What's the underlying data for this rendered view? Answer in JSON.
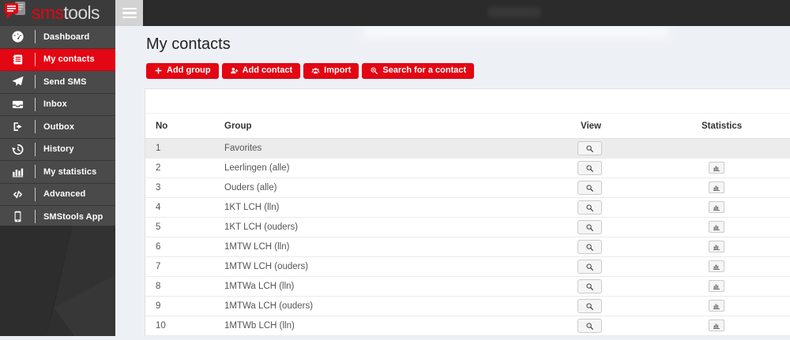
{
  "colors": {
    "brand_red": "#e30613",
    "sidebar_item_bg": "#4a4a4a",
    "topbar_bg": "#2b2b2b",
    "content_bg": "#edf0f5",
    "row_highlight": "#ececec"
  },
  "topbar": {
    "logo_sms": "sms",
    "logo_tools": "tools",
    "menu_toggle_icon": "hamburger-icon"
  },
  "sidebar": {
    "items": [
      {
        "label": "Dashboard",
        "icon": "gauge",
        "active": false
      },
      {
        "label": "My contacts",
        "icon": "address-book",
        "active": true
      },
      {
        "label": "Send SMS",
        "icon": "paper-plane",
        "active": false
      },
      {
        "label": "Inbox",
        "icon": "inbox",
        "active": false
      },
      {
        "label": "Outbox",
        "icon": "sign-out",
        "active": false
      },
      {
        "label": "History",
        "icon": "history",
        "active": false
      },
      {
        "label": "My statistics",
        "icon": "bar-chart",
        "active": false
      },
      {
        "label": "Advanced",
        "icon": "code",
        "active": false
      },
      {
        "label": "SMStools App",
        "icon": "mobile",
        "active": false
      }
    ]
  },
  "main": {
    "title": "My contacts",
    "buttons": [
      {
        "label": "Add group",
        "icon": "plus"
      },
      {
        "label": "Add contact",
        "icon": "user-plus"
      },
      {
        "label": "Import",
        "icon": "users"
      },
      {
        "label": "Search for a contact",
        "icon": "search-plus"
      }
    ],
    "table": {
      "columns": [
        "No",
        "Group",
        "View",
        "Statistics"
      ],
      "rows": [
        {
          "no": "1",
          "group": "Favorites",
          "view": true,
          "statistics": false,
          "highlight": true
        },
        {
          "no": "2",
          "group": "Leerlingen (alle)",
          "view": true,
          "statistics": true,
          "highlight": false
        },
        {
          "no": "3",
          "group": "Ouders (alle)",
          "view": true,
          "statistics": true,
          "highlight": false
        },
        {
          "no": "4",
          "group": "1KT LCH (lln)",
          "view": true,
          "statistics": true,
          "highlight": false
        },
        {
          "no": "5",
          "group": "1KT LCH (ouders)",
          "view": true,
          "statistics": true,
          "highlight": false
        },
        {
          "no": "6",
          "group": "1MTW LCH (lln)",
          "view": true,
          "statistics": true,
          "highlight": false
        },
        {
          "no": "7",
          "group": "1MTW LCH (ouders)",
          "view": true,
          "statistics": true,
          "highlight": false
        },
        {
          "no": "8",
          "group": "1MTWa LCH (lln)",
          "view": true,
          "statistics": true,
          "highlight": false
        },
        {
          "no": "9",
          "group": "1MTWa LCH (ouders)",
          "view": true,
          "statistics": true,
          "highlight": false
        },
        {
          "no": "10",
          "group": "1MTWb LCH (lln)",
          "view": true,
          "statistics": true,
          "highlight": false
        }
      ]
    }
  }
}
